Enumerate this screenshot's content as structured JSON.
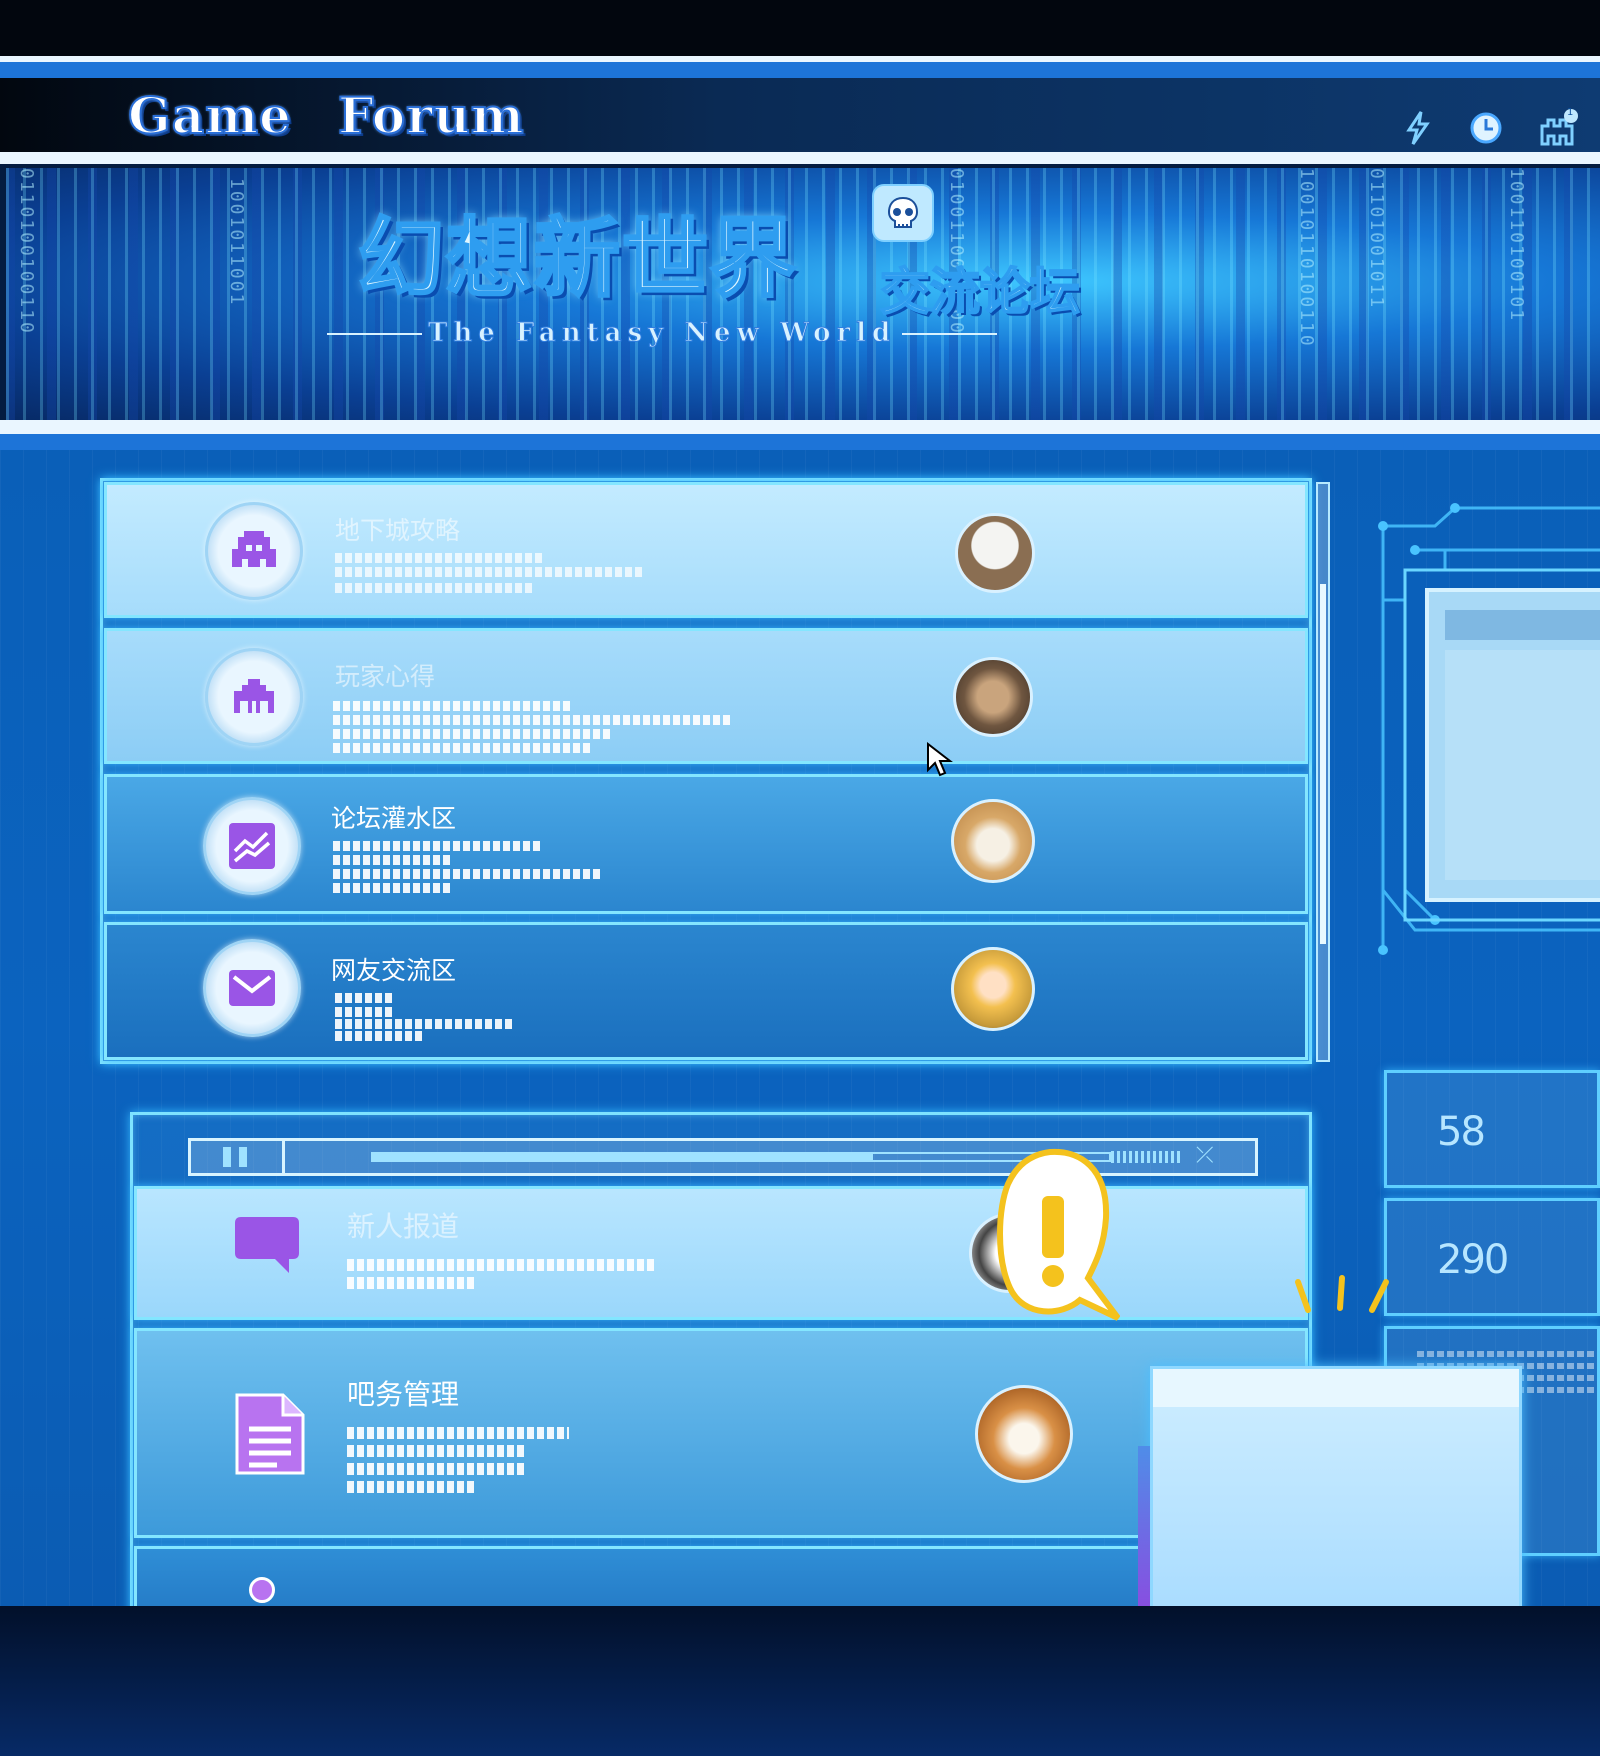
{
  "header": {
    "logo_word1": "Game",
    "logo_word2": "Forum",
    "icons": [
      "lightning-icon",
      "clock-icon",
      "invader-notification-icon"
    ],
    "notification_count": "1"
  },
  "banner": {
    "title_cn": "幻想新世界",
    "subtitle_cn": "交流论坛",
    "title_en": "The Fantasy New World"
  },
  "forum_sections": [
    {
      "title": "地下城攻略",
      "icon": "invader-icon",
      "avatar": "cup-avatar"
    },
    {
      "title": "玩家心得",
      "icon": "crab-invader-icon",
      "avatar": "cat-avatar"
    },
    {
      "title": "论坛灌水区",
      "icon": "chart-icon",
      "avatar": "shiba-avatar"
    },
    {
      "title": "网友交流区",
      "icon": "mail-icon",
      "avatar": "anime-girl-avatar"
    }
  ],
  "lower_sections": [
    {
      "title": "新人报道",
      "icon": "chat-bubble-icon"
    },
    {
      "title": "吧务管理",
      "icon": "document-icon",
      "avatar": "dog-avatar"
    }
  ],
  "stats": [
    "58",
    "290"
  ],
  "colors": {
    "accent": "#1d74d8",
    "icon_purple": "#9a55e6",
    "glow": "#7ee3ff",
    "alert_yellow": "#f4c21d"
  }
}
